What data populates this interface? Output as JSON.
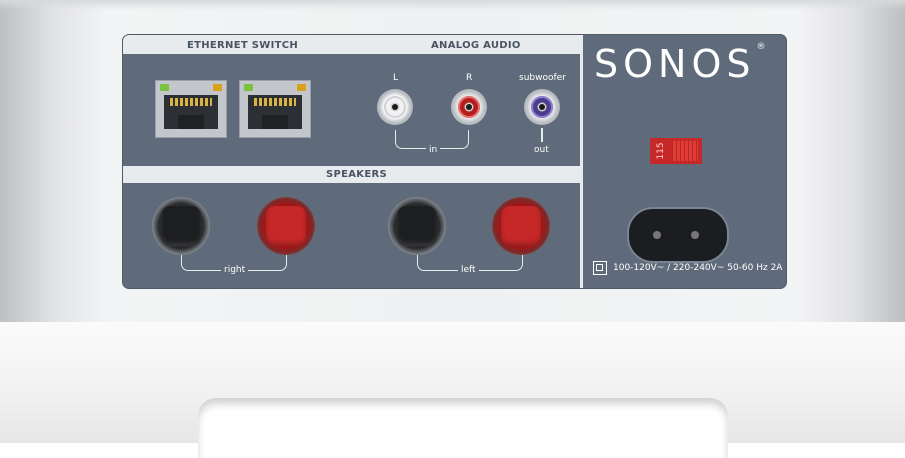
{
  "panel": {
    "sections": {
      "ethernet_switch": "ETHERNET SWITCH",
      "analog_audio": "ANALOG AUDIO",
      "speakers": "SPEAKERS"
    },
    "analog": {
      "left_label": "L",
      "right_label": "R",
      "subwoofer_label": "subwoofer",
      "in_label": "in",
      "out_label": "out"
    },
    "speakers": {
      "right_label": "right",
      "left_label": "left"
    },
    "brand": {
      "logo": "SONOS",
      "registered": "®"
    },
    "voltage_switch": {
      "label": "115"
    },
    "power": {
      "rating": "100-120V~ / 220-240V~  50-60 Hz  2A"
    }
  },
  "colors": {
    "panel": "#5f6b7a",
    "label_strip": "#e8ebee",
    "speaker_red": "#c62828",
    "speaker_black": "#1d1e20",
    "rca_red": "#b71c1c",
    "rca_white": "#f2f2f2",
    "rca_purple": "#4b3c8c",
    "led_green": "#7cc242",
    "led_amber": "#d9a21b"
  }
}
